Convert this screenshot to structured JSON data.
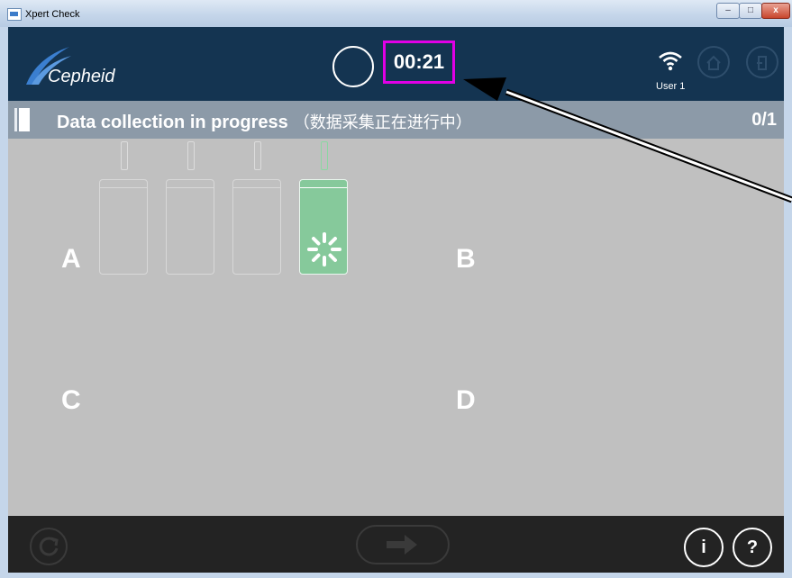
{
  "window": {
    "title": "Xpert Check"
  },
  "header": {
    "logo_text": "Cepheid",
    "timer": "00:21",
    "user": "User 1"
  },
  "subheader": {
    "title": "Data collection in progress",
    "title_cn": "（数据采集正在进行中）",
    "count": "0/1"
  },
  "modules": {
    "a_label": "A",
    "b_label": "B",
    "c_label": "C",
    "d_label": "D"
  },
  "footer": {
    "info_label": "i",
    "help_label": "?"
  },
  "colors": {
    "header_bg": "#143451",
    "subheader_bg": "#8c9aa8",
    "main_bg": "#c0c0c0",
    "active_module": "#86c99b",
    "timer_highlight": "#e100e6",
    "footer_bg": "#232323"
  },
  "icons": {
    "logo": "cepheid-swoosh-icon",
    "status": "status-circle-icon",
    "wifi": "wifi-icon",
    "home": "home-icon",
    "logout": "logout-icon",
    "cartridge": "cartridge-icon",
    "spinner": "spinner-icon",
    "refresh": "refresh-icon",
    "next": "arrow-right-icon"
  }
}
